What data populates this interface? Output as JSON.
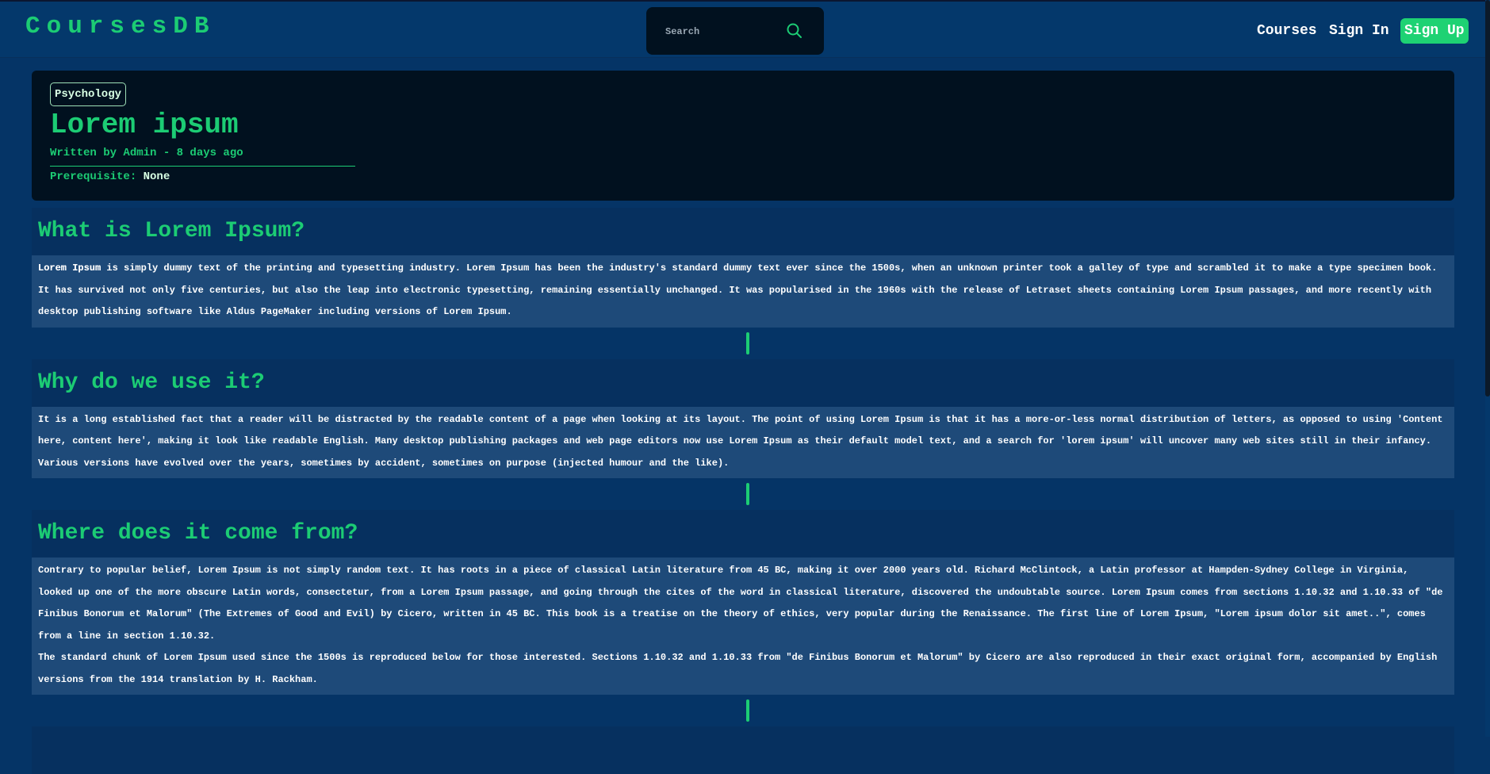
{
  "header": {
    "logo": "CoursesDB",
    "search_placeholder": "Search",
    "nav": [
      "Courses",
      "Sign In",
      "Sign Up"
    ]
  },
  "course": {
    "category": "Psychology",
    "title": "Lorem ipsum",
    "meta": "Written by Admin - 8 days ago",
    "prerequisite_label": "Prerequisite:",
    "prerequisite_value": "None"
  },
  "sections": [
    {
      "heading": "What is Lorem Ipsum?",
      "bold_lead": "Lorem Ipsum",
      "paragraphs": [
        " is simply dummy text of the printing and typesetting industry. Lorem Ipsum has been the industry's standard dummy text ever since the 1500s, when an unknown printer took a galley of type and scrambled it to make a type specimen book. It has survived not only five centuries, but also the leap into electronic typesetting, remaining essentially unchanged. It was popularised in the 1960s with the release of Letraset sheets containing Lorem Ipsum passages, and more recently with desktop publishing software like Aldus PageMaker including versions of Lorem Ipsum."
      ]
    },
    {
      "heading": "Why do we use it?",
      "paragraphs": [
        "It is a long established fact that a reader will be distracted by the readable content of a page when looking at its layout. The point of using Lorem Ipsum is that it has a more-or-less normal distribution of letters, as opposed to using 'Content here, content here', making it look like readable English. Many desktop publishing packages and web page editors now use Lorem Ipsum as their default model text, and a search for 'lorem ipsum' will uncover many web sites still in their infancy. Various versions have evolved over the years, sometimes by accident, sometimes on purpose (injected humour and the like)."
      ]
    },
    {
      "heading": "Where does it come from?",
      "paragraphs": [
        "Contrary to popular belief, Lorem Ipsum is not simply random text. It has roots in a piece of classical Latin literature from 45 BC, making it over 2000 years old. Richard McClintock, a Latin professor at Hampden-Sydney College in Virginia, looked up one of the more obscure Latin words, consectetur, from a Lorem Ipsum passage, and going through the cites of the word in classical literature, discovered the undoubtable source. Lorem Ipsum comes from sections 1.10.32 and 1.10.33 of \"de Finibus Bonorum et Malorum\" (The Extremes of Good and Evil) by Cicero, written in 45 BC. This book is a treatise on the theory of ethics, very popular during the Renaissance. The first line of Lorem Ipsum, \"Lorem ipsum dolor sit amet..\", comes from a line in section 1.10.32.",
        "The standard chunk of Lorem Ipsum used since the 1500s is reproduced below for those interested. Sections 1.10.32 and 1.10.33 from \"de Finibus Bonorum et Malorum\" by Cicero are also reproduced in their exact original form, accompanied by English versions from the 1914 translation by H. Rackham."
      ]
    }
  ],
  "colors": {
    "accent": "#1ccc74",
    "header_bg": "#04386b",
    "card_bg": "#01111f",
    "section_head_bg": "#06305f",
    "section_body_bg": "#1e4a79"
  },
  "icons": {
    "search": "magnifier-icon"
  }
}
